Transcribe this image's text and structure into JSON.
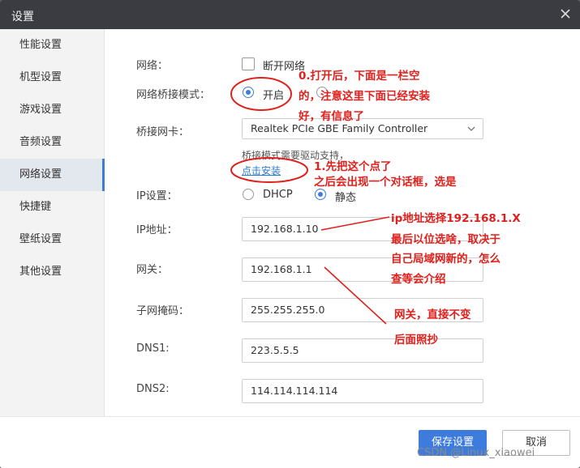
{
  "window": {
    "title": "设置"
  },
  "sidebar": {
    "items": [
      {
        "label": "性能设置"
      },
      {
        "label": "机型设置"
      },
      {
        "label": "游戏设置"
      },
      {
        "label": "音频设置"
      },
      {
        "label": "网络设置",
        "active": true
      },
      {
        "label": "快捷键"
      },
      {
        "label": "壁纸设置"
      },
      {
        "label": "其他设置"
      }
    ]
  },
  "network": {
    "network_label": "网络：",
    "disconnect_label": "断开网络",
    "disconnect_checked": false,
    "bridge_mode_label": "网络桥接模式：",
    "bridge_on_label": "开启",
    "bridge_on_selected": true,
    "bridge_nic_label": "桥接网卡：",
    "bridge_nic_value": "Realtek PCIe GBE Family Controller",
    "driver_hint": "桥接模式需要驱动支持，",
    "install_link": "点击安装",
    "ip_setting_label": "IP设置：",
    "ip_mode_dhcp": "DHCP",
    "ip_mode_static": "静态",
    "ip_mode_selected": "静态",
    "ip_label": "IP地址：",
    "ip_value": "192.168.1.10",
    "gateway_label": "网关：",
    "gateway_value": "192.168.1.1",
    "subnet_label": "子网掩码：",
    "subnet_value": "255.255.255.0",
    "dns1_label": "DNS1:",
    "dns1_value": "223.5.5.5",
    "dns2_label": "DNS2:",
    "dns2_value": "114.114.114.114"
  },
  "footer": {
    "save_label": "保存设置",
    "cancel_label": "取消"
  },
  "annotations": {
    "step0_line1": "0.打开后，下面是一栏空",
    "step0_line2": "的，注意这里下面已经安装",
    "step0_line3": "好，有信息了",
    "step1_line1": "1.先把这个点了",
    "step1_line2": "之后会出现一个对话框，选是",
    "ip_line1": "ip地址选择192.168.1.X",
    "ip_line2": "最后以位选啥，取决于",
    "ip_line3": "自己局域网新的，怎么",
    "ip_line4": "查等会介绍",
    "gw_line1": "网关，直接不变",
    "gw_line2": "后面照抄",
    "color": "#e0201c"
  },
  "watermark": "CSDN @Linux_xiaowei",
  "colors": {
    "accent": "#3d7bdc",
    "titlebar": "#3a3c42",
    "link": "#2a7ad5"
  }
}
